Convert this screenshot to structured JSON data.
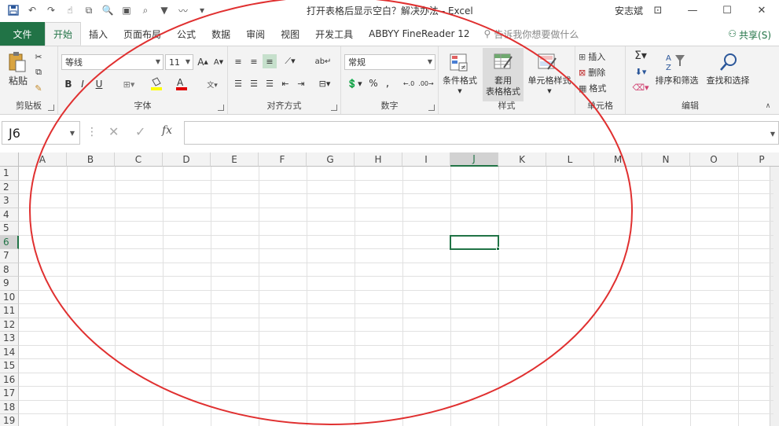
{
  "window": {
    "title": "打开表格后显示空白？解决办法 - Excel",
    "user": "安志斌"
  },
  "tabs": {
    "file": "文件",
    "items": [
      "开始",
      "插入",
      "页面布局",
      "公式",
      "数据",
      "审阅",
      "视图",
      "开发工具",
      "ABBYY FineReader 12"
    ],
    "active": "开始",
    "tell_me": "告诉我你想要做什么",
    "share": "共享(S)"
  },
  "ribbon": {
    "clipboard": {
      "paste": "粘贴",
      "label": "剪贴板"
    },
    "font": {
      "name": "等线",
      "size": "11",
      "label": "字体",
      "bold": "B",
      "italic": "I",
      "underline": "U",
      "grow": "A",
      "shrink": "A"
    },
    "alignment": {
      "label": "对齐方式"
    },
    "number": {
      "format": "常规",
      "label": "数字",
      "percent": "%",
      "comma": ","
    },
    "styles": {
      "conditional": "条件格式",
      "table_line1": "套用",
      "table_line2": "表格格式",
      "cell_styles": "单元格样式",
      "label": "样式"
    },
    "cells": {
      "insert": "插入",
      "delete": "删除",
      "format": "格式",
      "label": "单元格"
    },
    "editing": {
      "sort": "排序和筛选",
      "find": "查找和选择",
      "label": "编辑"
    }
  },
  "formula_bar": {
    "name_box": "J6",
    "fx": "fx",
    "value": ""
  },
  "sheet": {
    "columns": [
      "A",
      "B",
      "C",
      "D",
      "E",
      "F",
      "G",
      "H",
      "I",
      "J",
      "K",
      "L",
      "M",
      "N",
      "O",
      "P"
    ],
    "rows": [
      "1",
      "2",
      "3",
      "4",
      "5",
      "6",
      "7",
      "8",
      "9",
      "10",
      "11",
      "12",
      "13",
      "14",
      "15",
      "16",
      "17",
      "18",
      "19"
    ],
    "selected_column": "J",
    "selected_row": "6"
  },
  "colors": {
    "accent": "#217346",
    "annotation": "#e03030"
  }
}
